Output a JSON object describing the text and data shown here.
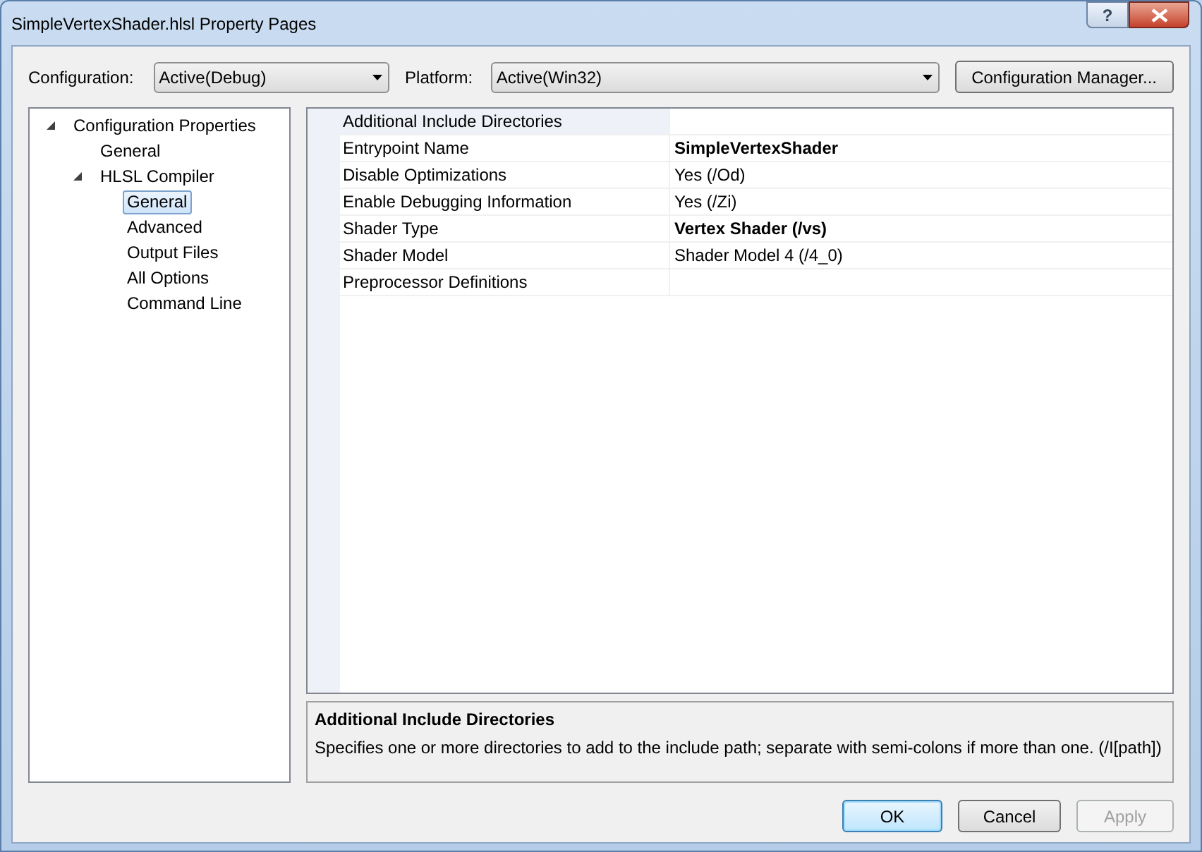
{
  "window": {
    "title": "SimpleVertexShader.hlsl Property Pages",
    "help_glyph": "?"
  },
  "toolbar": {
    "configuration_label": "Configuration:",
    "configuration_value": "Active(Debug)",
    "platform_label": "Platform:",
    "platform_value": "Active(Win32)",
    "manager_button": "Configuration Manager..."
  },
  "tree": [
    {
      "label": "Configuration Properties",
      "expanded": true,
      "selected": false,
      "children": [
        {
          "label": "General",
          "selected": false
        },
        {
          "label": "HLSL Compiler",
          "expanded": true,
          "selected": false,
          "children": [
            {
              "label": "General",
              "selected": true
            },
            {
              "label": "Advanced",
              "selected": false
            },
            {
              "label": "Output Files",
              "selected": false
            },
            {
              "label": "All Options",
              "selected": false
            },
            {
              "label": "Command Line",
              "selected": false
            }
          ]
        }
      ]
    }
  ],
  "properties": [
    {
      "name": "Additional Include Directories",
      "selected": true
    },
    {
      "name": "Entrypoint Name",
      "value": "SimpleVertexShader",
      "selected": false,
      "bold": true
    },
    {
      "name": "Disable Optimizations",
      "value": "Yes (/Od)",
      "selected": false,
      "bold": false
    },
    {
      "name": "Enable Debugging Information",
      "value": "Yes (/Zi)",
      "selected": false,
      "bold": false
    },
    {
      "name": "Shader Type",
      "value": "Vertex Shader (/vs)",
      "selected": false,
      "bold": true
    },
    {
      "name": "Shader Model",
      "value": "Shader Model 4 (/4_0)",
      "selected": false,
      "bold": false
    },
    {
      "name": "Preprocessor Definitions",
      "selected": false
    }
  ],
  "description": {
    "title": "Additional Include Directories",
    "text": "Specifies one or more directories to add to the include path; separate with semi-colons if more than one. (/I[path])"
  },
  "buttons": [
    {
      "label": "OK",
      "default": true,
      "disabled": false
    },
    {
      "label": "Cancel",
      "default": false,
      "disabled": false
    },
    {
      "label": "Apply",
      "disabled": true
    }
  ]
}
